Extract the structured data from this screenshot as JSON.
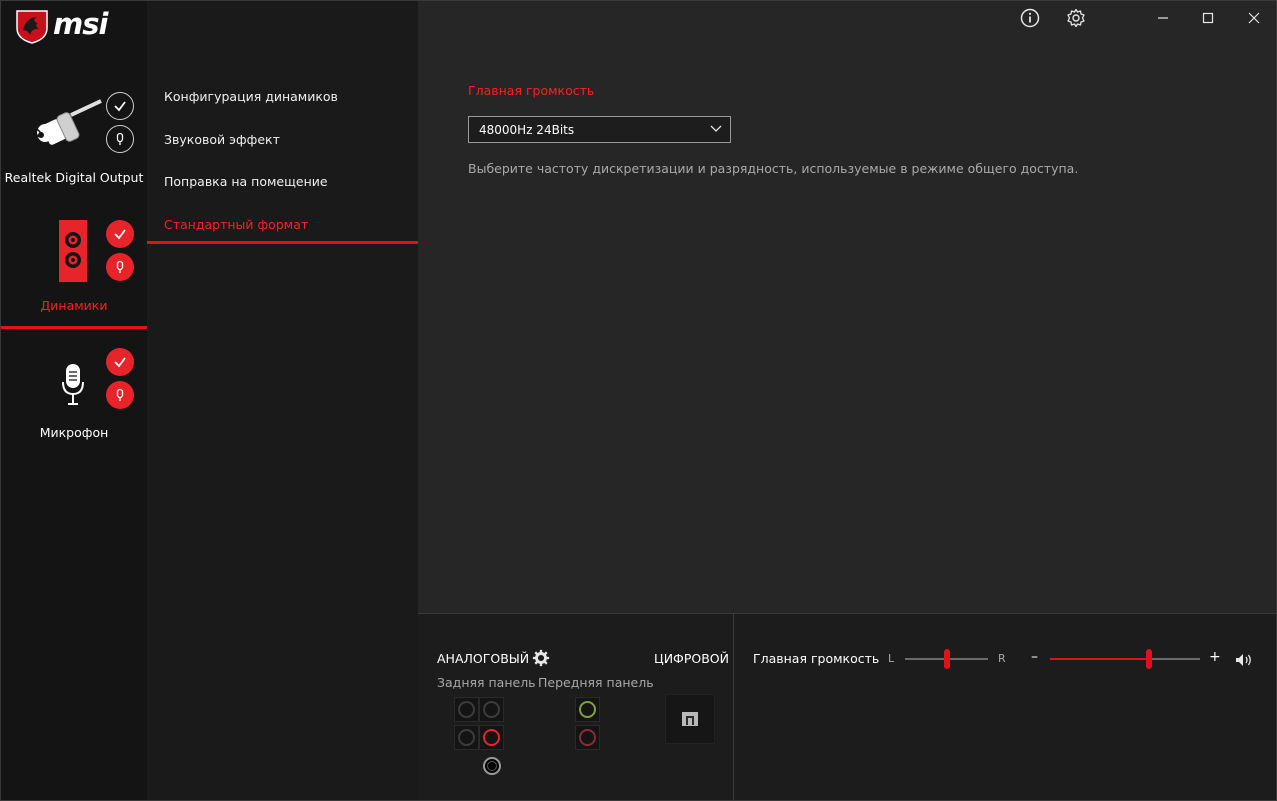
{
  "app": {
    "brand": "msi",
    "accent_color": "#e0111a"
  },
  "titlebar": {
    "info_icon": "info-icon",
    "settings_icon": "gear-icon",
    "minimize_icon": "minimize-icon",
    "maximize_icon": "maximize-icon",
    "close_icon": "close-icon"
  },
  "devices": [
    {
      "label": "Realtek Digital Output",
      "active": false,
      "icon": "spdif-cable-icon"
    },
    {
      "label": "Динамики",
      "active": true,
      "icon": "speaker-icon"
    },
    {
      "label": "Микрофон",
      "active": false,
      "icon": "microphone-icon"
    }
  ],
  "submenu": {
    "items": [
      {
        "label": "Конфигурация динамиков",
        "active": false
      },
      {
        "label": "Звуковой эффект",
        "active": false
      },
      {
        "label": "Поправка на помещение",
        "active": false
      },
      {
        "label": "Стандартный формат",
        "active": true
      }
    ]
  },
  "main": {
    "section_title": "Главная громкость",
    "format_select": {
      "value": "48000Hz 24Bits"
    },
    "description": "Выберите частоту дискретизации и разрядность, используемые в режиме общего доступа."
  },
  "bottom": {
    "analog_label": "АНАЛОГОВЫЙ",
    "digital_label": "ЦИФРОВОЙ",
    "rear_panel_label": "Задняя панель",
    "front_panel_label": "Передняя панель",
    "volume_label": "Главная громкость",
    "balance_left": "L",
    "balance_right": "R",
    "volume_minus": "–",
    "volume_plus": "+",
    "balance_value": 0.5,
    "volume_value": 0.66
  }
}
